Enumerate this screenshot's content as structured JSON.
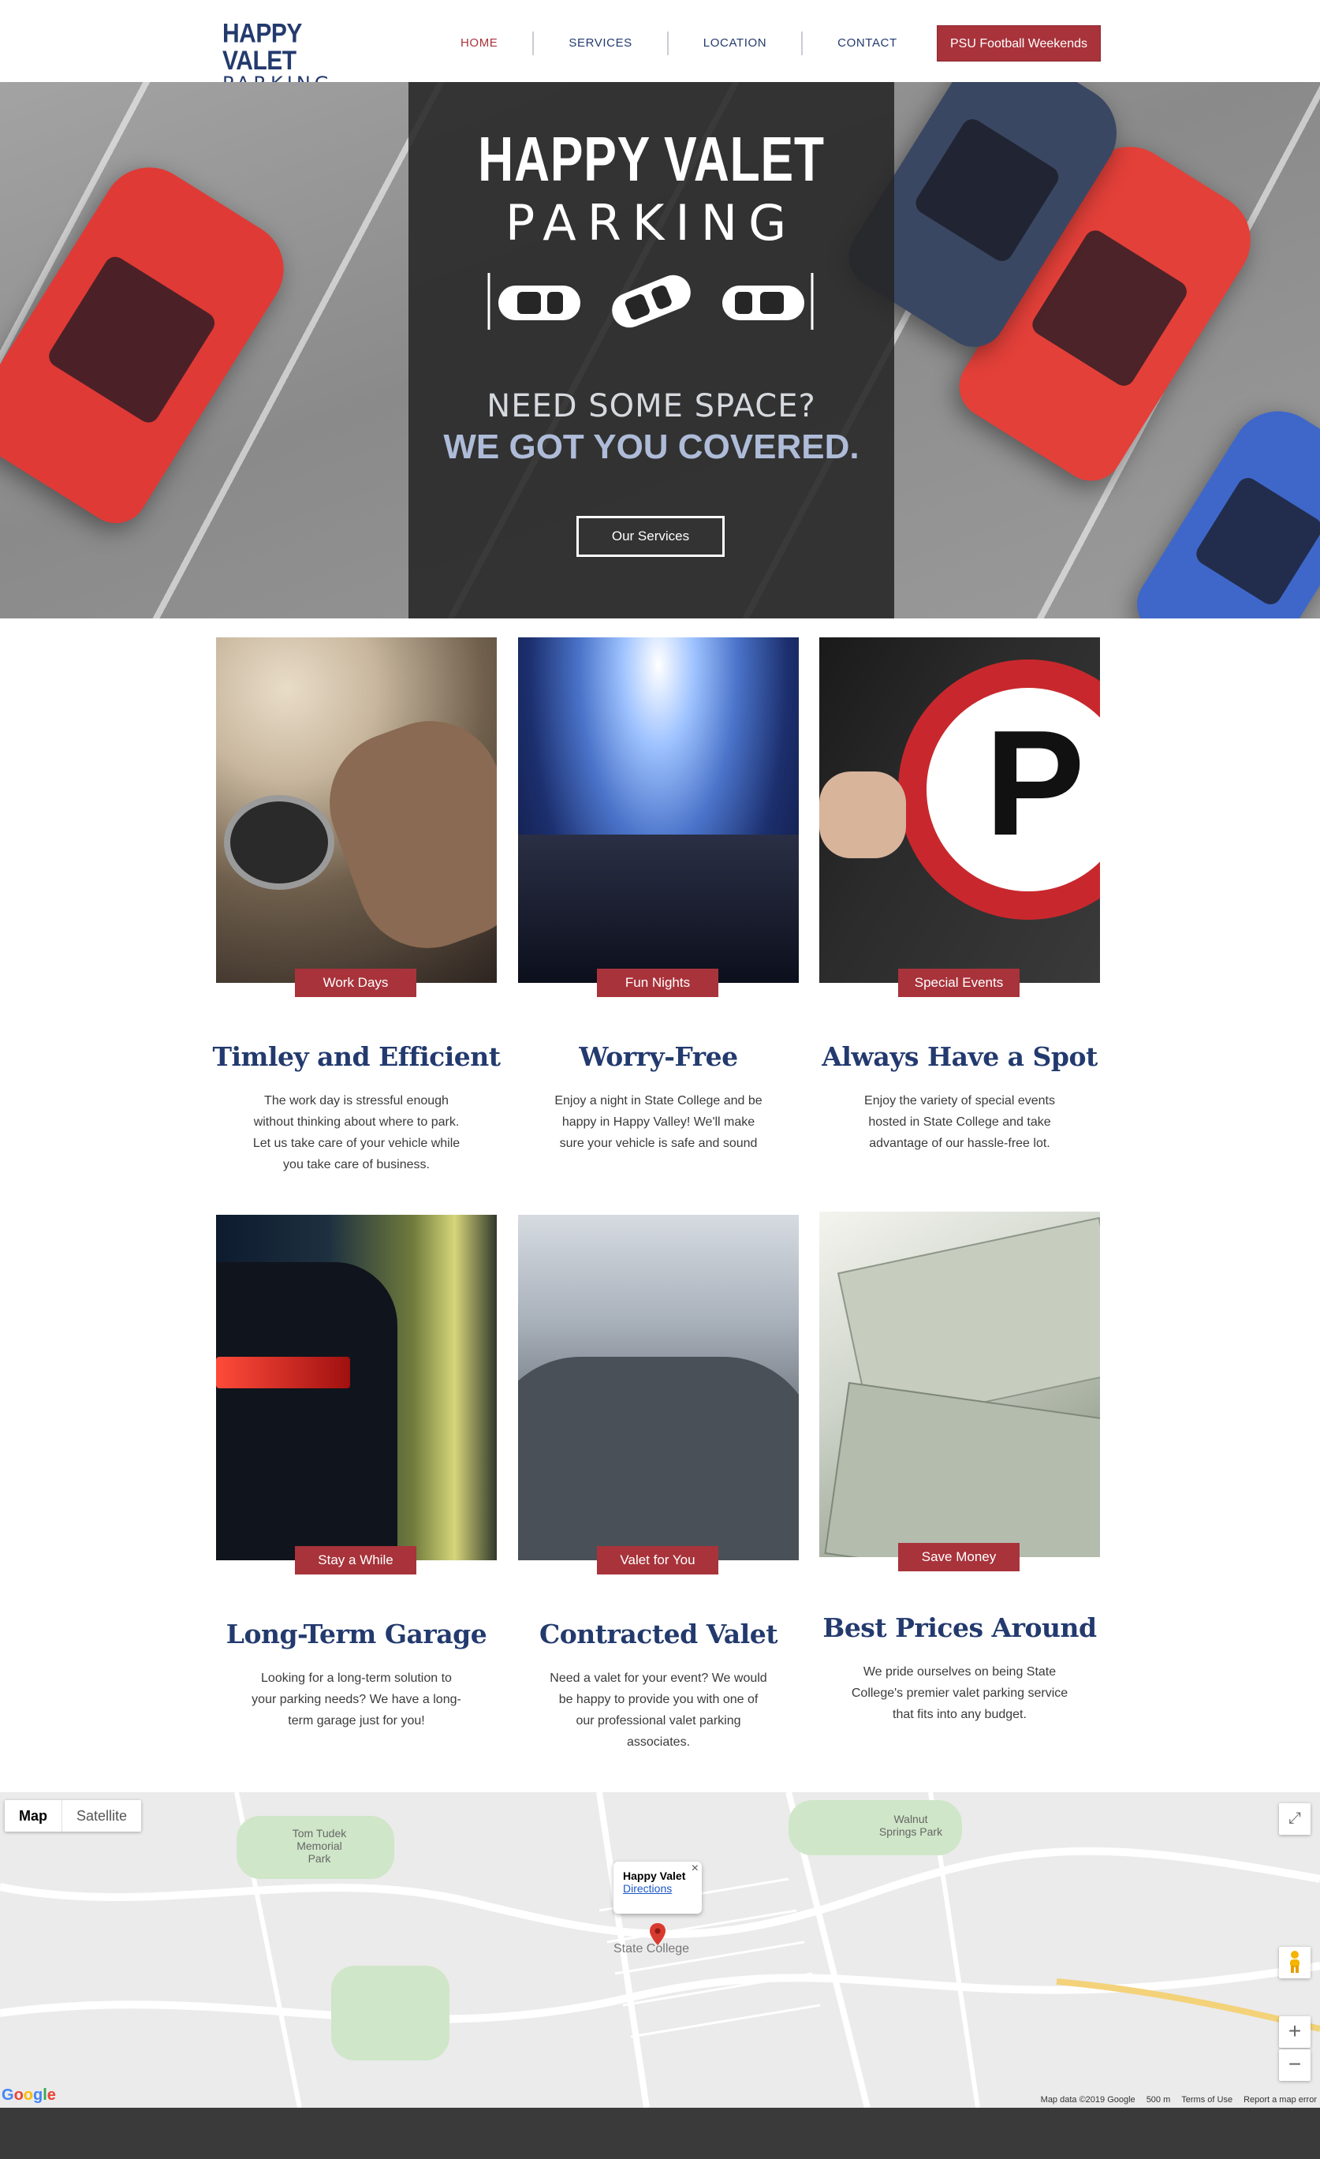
{
  "header": {
    "logo_line1": "HAPPY VALET",
    "logo_line2": "PARKING",
    "nav": [
      "HOME",
      "SERVICES",
      "LOCATION",
      "CONTACT"
    ],
    "cta": "PSU Football Weekends"
  },
  "hero": {
    "title1": "HAPPY VALET",
    "title2": "PARKING",
    "tagline1": "NEED SOME SPACE?",
    "tagline2": "WE GOT YOU COVERED.",
    "button": "Our Services"
  },
  "cards": [
    {
      "tag": "Work Days",
      "title": "Timley and Efficient",
      "text": "The work day is stressful enough without thinking about where to park. Let us take care of your vehicle while you take care of business."
    },
    {
      "tag": "Fun Nights",
      "title": "Worry-Free",
      "text": "Enjoy a night in State College and be happy in Happy Valley! We'll make sure your vehicle is safe and sound"
    },
    {
      "tag": "Special Events",
      "title": "Always Have a Spot",
      "text": "Enjoy the variety of special events hosted in State College and take advantage of our hassle-free lot."
    },
    {
      "tag": "Stay a While",
      "title": "Long-Term Garage",
      "text": "Looking for a long-term solution to your parking needs? We have a long-term garage just for you!"
    },
    {
      "tag": "Valet for You",
      "title": "Contracted Valet",
      "text": "Need a valet for your event? We would be happy to provide you with one of our professional valet parking associates."
    },
    {
      "tag": "Save Money",
      "title": "Best Prices Around",
      "text": "We pride ourselves on being State College's premier valet parking service that fits into any budget."
    }
  ],
  "map": {
    "tab_map": "Map",
    "tab_satellite": "Satellite",
    "popup_name": "Happy Valet",
    "popup_link": "Directions",
    "place_main": "State College",
    "places": [
      "Tom Tudek Memorial Park",
      "Walnut Springs Park"
    ],
    "footer": [
      "Map data ©2019 Google",
      "500 m",
      "Terms of Use",
      "Report a map error"
    ],
    "brand": "Google"
  },
  "colors": {
    "brand_navy": "#233a6e",
    "accent_red": "#a8333b",
    "dark_panel": "#262626"
  }
}
